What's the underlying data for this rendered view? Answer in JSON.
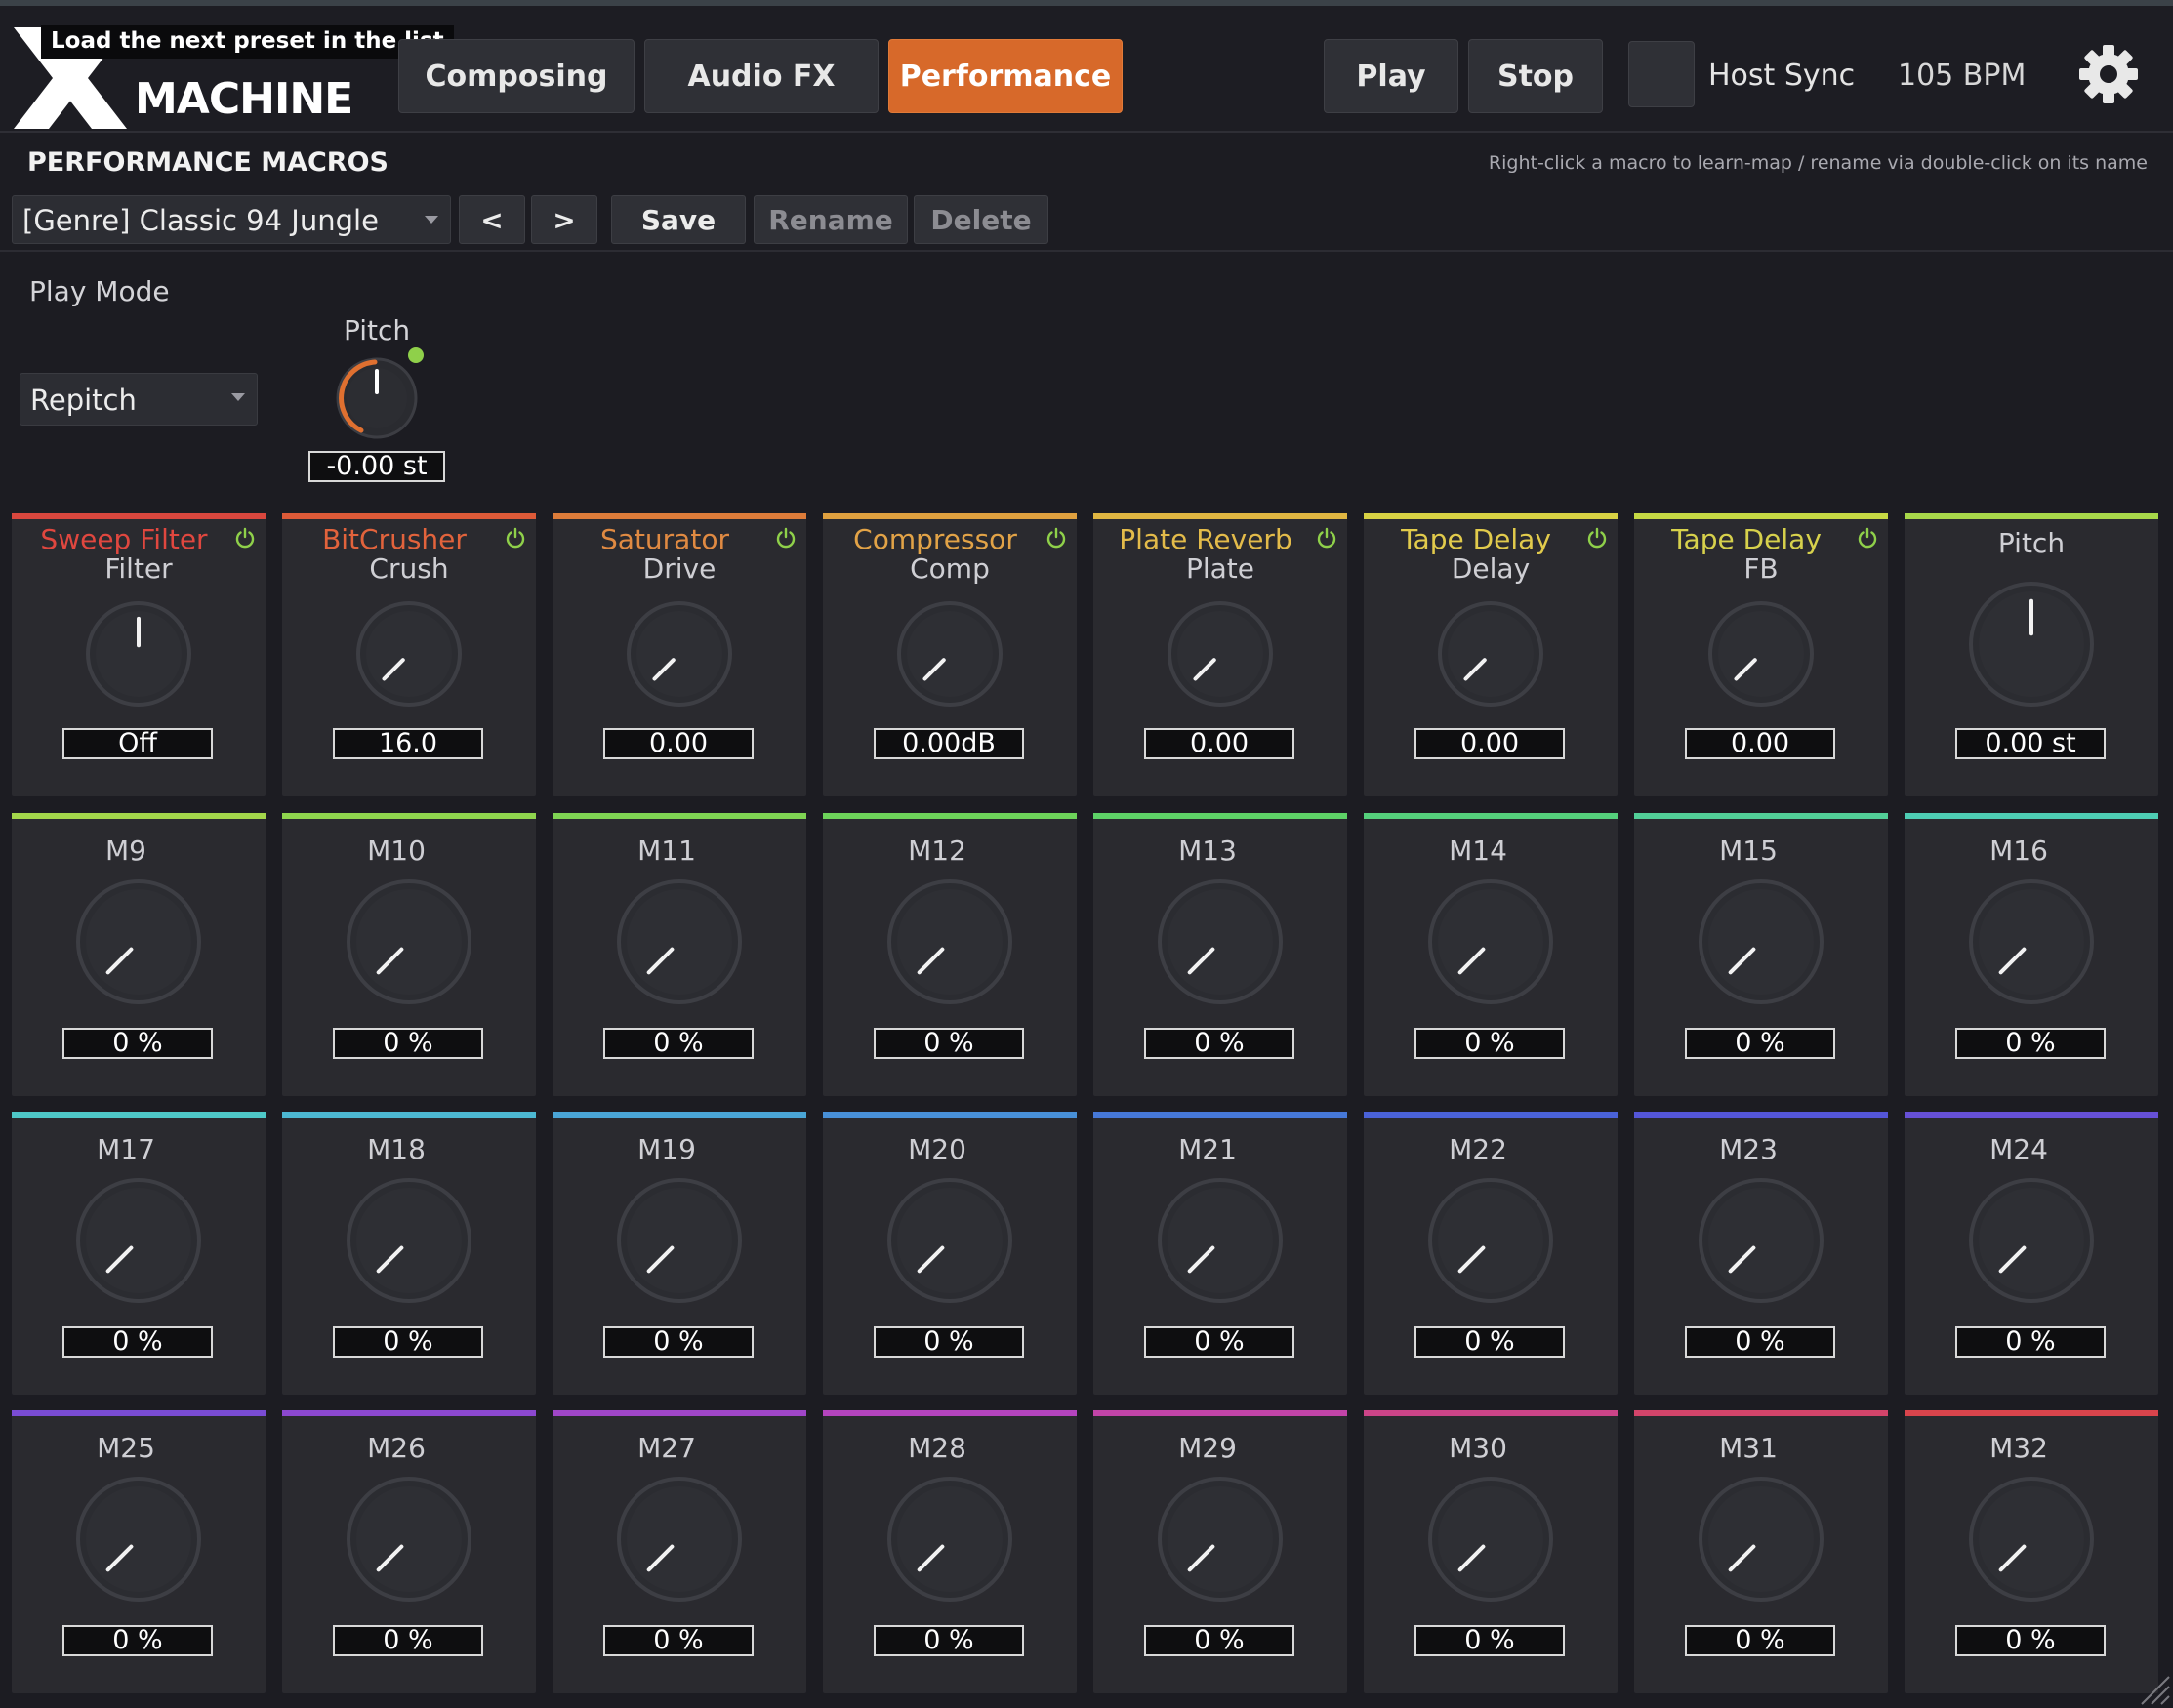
{
  "app": {
    "logo_text": "MACHINE",
    "tooltip": "Load the next preset in the list"
  },
  "tabs": [
    {
      "label": "Composing",
      "active": false
    },
    {
      "label": "Audio FX",
      "active": false
    },
    {
      "label": "Performance",
      "active": true
    }
  ],
  "transport": {
    "play_label": "Play",
    "stop_label": "Stop",
    "host_sync_label": "Host Sync",
    "host_sync_checked": false,
    "bpm": "105 BPM"
  },
  "section": {
    "title": "PERFORMANCE MACROS",
    "hint": "Right-click a macro to learn-map / rename via double-click on its name"
  },
  "preset": {
    "selected": "[Genre] Classic 94 Jungle",
    "prev_label": "<",
    "next_label": ">",
    "save_label": "Save",
    "rename_label": "Rename",
    "delete_label": "Delete"
  },
  "play_mode": {
    "label": "Play Mode",
    "selected": "Repitch"
  },
  "pitch": {
    "label": "Pitch",
    "value": "-0.00 st"
  },
  "colors": {
    "accent": "#d7692a",
    "power_green": "#8fd04a"
  },
  "macros": [
    {
      "fx": "Sweep Filter",
      "param": "Filter",
      "value": "Off",
      "fx_color": "#e0473f",
      "bar": "#d9473e",
      "knob_level": 0.5,
      "power": true
    },
    {
      "fx": "BitCrusher",
      "param": "Crush",
      "value": "16.0",
      "fx_color": "#e2633c",
      "bar": "#dd5a38",
      "knob_level": 0.0,
      "power": true
    },
    {
      "fx": "Saturator",
      "param": "Drive",
      "value": "0.00",
      "fx_color": "#e08a42",
      "bar": "#dd7c3a",
      "knob_level": 0.0,
      "power": true
    },
    {
      "fx": "Compressor",
      "param": "Comp",
      "value": "0.00dB",
      "fx_color": "#e2a347",
      "bar": "#dfa03f",
      "knob_level": 0.0,
      "power": true
    },
    {
      "fx": "Plate Reverb",
      "param": "Plate",
      "value": "0.00",
      "fx_color": "#e3bb4a",
      "bar": "#e0b642",
      "knob_level": 0.0,
      "power": true
    },
    {
      "fx": "Tape Delay",
      "param": "Delay",
      "value": "0.00",
      "fx_color": "#e2cb4c",
      "bar": "#d8d244",
      "knob_level": 0.0,
      "power": true
    },
    {
      "fx": "Tape Delay",
      "param": "FB",
      "value": "0.00",
      "fx_color": "#d7d14c",
      "bar": "#c6d944",
      "knob_level": 0.0,
      "power": true
    },
    {
      "fx": "",
      "param": "",
      "name": "Pitch",
      "value": "0.00 st",
      "bar": "#a8d84a",
      "knob_level": 0.5,
      "power": false
    },
    {
      "name": "M9",
      "value": "0 %",
      "bar": "#a3d64b",
      "knob_level": 0.0
    },
    {
      "name": "M10",
      "value": "0 %",
      "bar": "#8fd54e",
      "knob_level": 0.0
    },
    {
      "name": "M11",
      "value": "0 %",
      "bar": "#7fd453",
      "knob_level": 0.0
    },
    {
      "name": "M12",
      "value": "0 %",
      "bar": "#6dd35a",
      "knob_level": 0.0
    },
    {
      "name": "M13",
      "value": "0 %",
      "bar": "#5ed267",
      "knob_level": 0.0
    },
    {
      "name": "M14",
      "value": "0 %",
      "bar": "#55d07c",
      "knob_level": 0.0
    },
    {
      "name": "M15",
      "value": "0 %",
      "bar": "#52cf98",
      "knob_level": 0.0
    },
    {
      "name": "M16",
      "value": "0 %",
      "bar": "#4ecdb4",
      "knob_level": 0.0
    },
    {
      "name": "M17",
      "value": "0 %",
      "bar": "#4ec8c8",
      "knob_level": 0.0
    },
    {
      "name": "M18",
      "value": "0 %",
      "bar": "#4cb8d2",
      "knob_level": 0.0
    },
    {
      "name": "M19",
      "value": "0 %",
      "bar": "#4aa5d6",
      "knob_level": 0.0
    },
    {
      "name": "M20",
      "value": "0 %",
      "bar": "#4890d8",
      "knob_level": 0.0
    },
    {
      "name": "M21",
      "value": "0 %",
      "bar": "#4678d8",
      "knob_level": 0.0
    },
    {
      "name": "M22",
      "value": "0 %",
      "bar": "#4a62d8",
      "knob_level": 0.0
    },
    {
      "name": "M23",
      "value": "0 %",
      "bar": "#5456d8",
      "knob_level": 0.0
    },
    {
      "name": "M24",
      "value": "0 %",
      "bar": "#6650d6",
      "knob_level": 0.0
    },
    {
      "name": "M25",
      "value": "0 %",
      "bar": "#7a4cd4",
      "knob_level": 0.0
    },
    {
      "name": "M26",
      "value": "0 %",
      "bar": "#8c48d0",
      "knob_level": 0.0
    },
    {
      "name": "M27",
      "value": "0 %",
      "bar": "#a046c8",
      "knob_level": 0.0
    },
    {
      "name": "M28",
      "value": "0 %",
      "bar": "#b444be",
      "knob_level": 0.0
    },
    {
      "name": "M29",
      "value": "0 %",
      "bar": "#c244a8",
      "knob_level": 0.0
    },
    {
      "name": "M30",
      "value": "0 %",
      "bar": "#cc4488",
      "knob_level": 0.0
    },
    {
      "name": "M31",
      "value": "0 %",
      "bar": "#d3446a",
      "knob_level": 0.0
    },
    {
      "name": "M32",
      "value": "0 %",
      "bar": "#d9444c",
      "knob_level": 0.0
    }
  ]
}
